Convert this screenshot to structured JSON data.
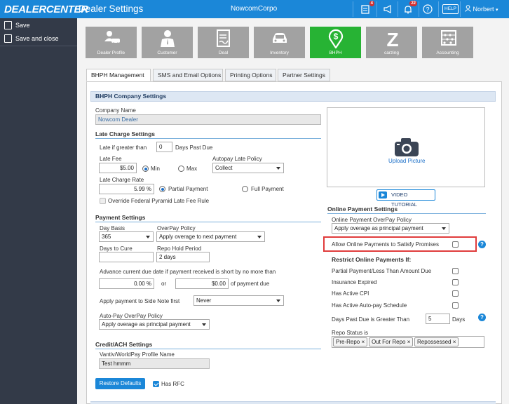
{
  "topbar": {
    "logo": "DEALERCENTER",
    "title": "Dealer Settings",
    "company": "NowcomCorpo",
    "badge_notes": "4",
    "badge_bell": "22",
    "help_label": "HELP",
    "user": "Norbert",
    "accent": "#1b87d8"
  },
  "sidebar": {
    "save": "Save",
    "save_close": "Save and close"
  },
  "tiles": [
    {
      "label": "Dealer Profile",
      "icon": "dealer-profile-icon"
    },
    {
      "label": "Customer",
      "icon": "customer-icon"
    },
    {
      "label": "Deal",
      "icon": "deal-icon"
    },
    {
      "label": "Inventory",
      "icon": "inventory-icon"
    },
    {
      "label": "BHPH",
      "icon": "bhph-icon"
    },
    {
      "label": "carzing",
      "icon": "carzing-icon"
    },
    {
      "label": "Accounting",
      "icon": "accounting-icon"
    }
  ],
  "tabs": [
    "BHPH Management",
    "SMS and Email Options",
    "Printing Options",
    "Partner Settings"
  ],
  "section": {
    "title": "BHPH Company Settings"
  },
  "company": {
    "label": "Company Name",
    "value": "Nowcom Dealer"
  },
  "late": {
    "heading": "Late Charge Settings",
    "if_greater": "Late if greater than",
    "days_value": "0",
    "days_past_due": "Days Past Due",
    "autopay_label": "Autopay Late Policy",
    "autopay_value": "Collect",
    "fee_label": "Late Fee",
    "fee_value": "$5.00",
    "min": "Min",
    "max": "Max",
    "rate_label": "Late Charge Rate",
    "rate_value": "5.99 %",
    "partial": "Partial Payment",
    "full": "Full Payment",
    "override": "Override Federal Pyramid Late Fee Rule"
  },
  "payment": {
    "heading": "Payment Settings",
    "day_basis_label": "Day Basis",
    "day_basis_value": "365",
    "overpay_label": "OverPay Policy",
    "overpay_value": "Apply overage to next payment",
    "days_cure_label": "Days to Cure",
    "days_cure_value": "",
    "repo_hold_label": "Repo Hold Period",
    "repo_hold_value": "2 days",
    "advance_text": "Advance current due date if payment received is short by no more than",
    "advance_pct": "0.00 %",
    "or": "or",
    "advance_amt": "$0.00",
    "of_payment_due": "of payment due",
    "side_note_label": "Apply payment to Side Note first",
    "side_note_value": "Never",
    "autopay_over_label": "Auto-Pay OverPay Policy",
    "autopay_over_value": "Apply overage as principal payment"
  },
  "credit": {
    "heading": "Credit/ACH Settings",
    "profile_label": "Vantiv/WorldPay Profile Name",
    "profile_value": "Test hmmm"
  },
  "footer": {
    "restore": "Restore Defaults",
    "has_rfc": "Has RFC"
  },
  "upload": {
    "label": "Upload Picture",
    "video": "VIDEO TUTORIAL"
  },
  "online": {
    "heading": "Online Payment Settings",
    "overpay_label": "Online Payment OverPay Policy",
    "overpay_value": "Apply overage as principal payment",
    "allow_promises": "Allow Online Payments to Satisfy Promises",
    "restrict_heading": "Restrict Online Payments If:",
    "partial_less": "Partial Payment/Less Than Amount Due",
    "insurance": "Insurance Expired",
    "cpi": "Has Active CPI",
    "autopay_schedule": "Has Active Auto-pay Schedule",
    "days_past_label": "Days Past Due is Greater Than",
    "days_past_value": "5",
    "days_unit": "Days",
    "repo_status_label": "Repo Status is",
    "repo_tags": [
      "Pre-Repo",
      "Out For Repo",
      "Repossessed"
    ],
    "highlight_color": "#e03c3c"
  }
}
